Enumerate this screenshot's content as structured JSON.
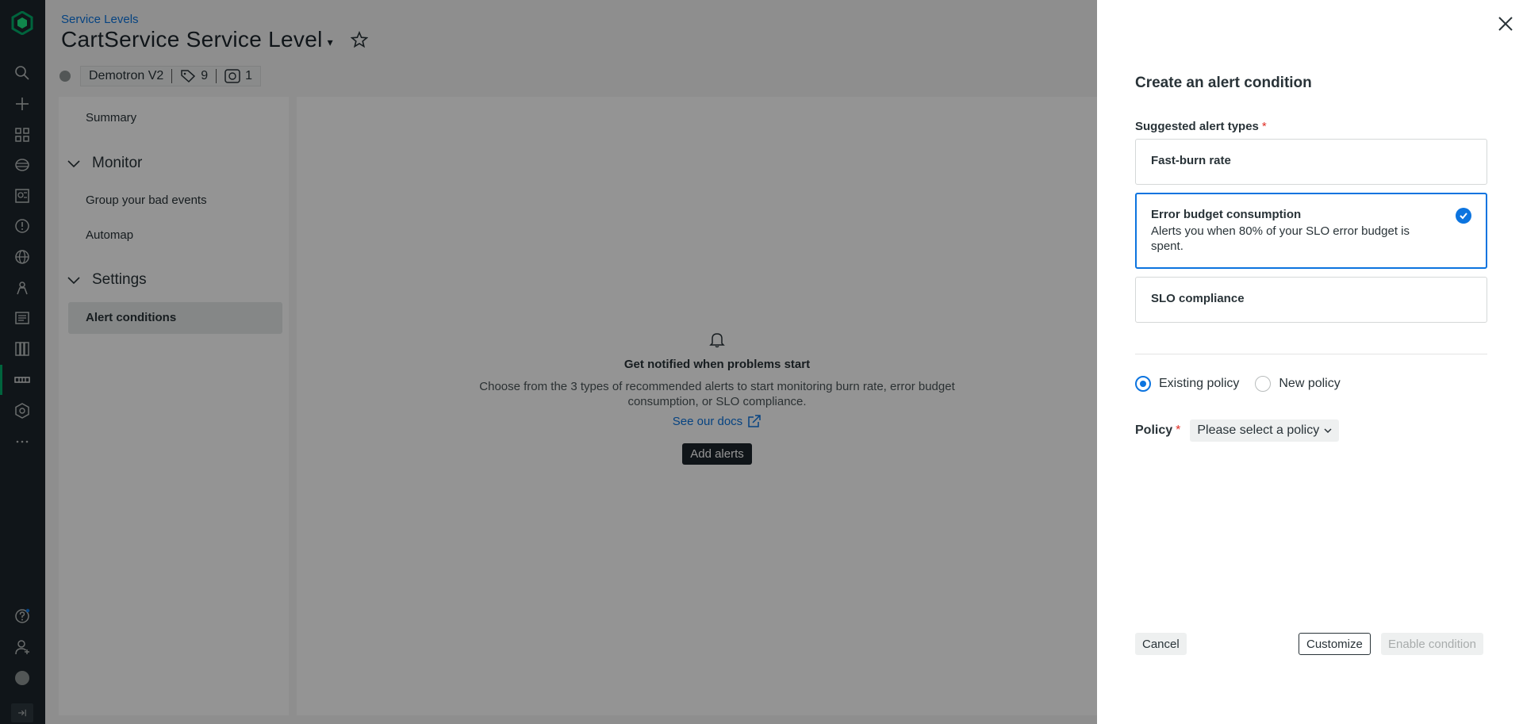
{
  "header": {
    "breadcrumb": "Service Levels",
    "title": "CartService Service Level",
    "entity_name": "Demotron V2",
    "tag_count": "9",
    "related_count": "1"
  },
  "sidebar": {
    "summary": "Summary",
    "monitor_section": "Monitor",
    "group_bad_events": "Group your bad events",
    "automap": "Automap",
    "settings_section": "Settings",
    "alert_conditions": "Alert conditions"
  },
  "empty_state": {
    "title": "Get notified when problems start",
    "description": "Choose from the 3 types of recommended alerts to start monitoring burn rate, error budget consumption, or SLO compliance.",
    "docs_link": "See our docs",
    "add_button": "Add alerts"
  },
  "drawer": {
    "title": "Create an alert condition",
    "suggested_label": "Suggested alert types",
    "required_mark": "*",
    "cards": [
      {
        "title": "Fast-burn rate",
        "description": "",
        "selected": false
      },
      {
        "title": "Error budget consumption",
        "description": "Alerts you when 80% of your SLO error budget is spent.",
        "selected": true
      },
      {
        "title": "SLO compliance",
        "description": "",
        "selected": false
      }
    ],
    "policy_options": {
      "existing": "Existing policy",
      "new": "New policy",
      "selected": "existing"
    },
    "policy_label": "Policy",
    "policy_placeholder": "Please select a policy",
    "buttons": {
      "cancel": "Cancel",
      "customize": "Customize",
      "enable": "Enable condition"
    }
  },
  "colors": {
    "accent": "#0c74df",
    "nav_bg": "#1d252c",
    "brand_green": "#00ac69"
  }
}
